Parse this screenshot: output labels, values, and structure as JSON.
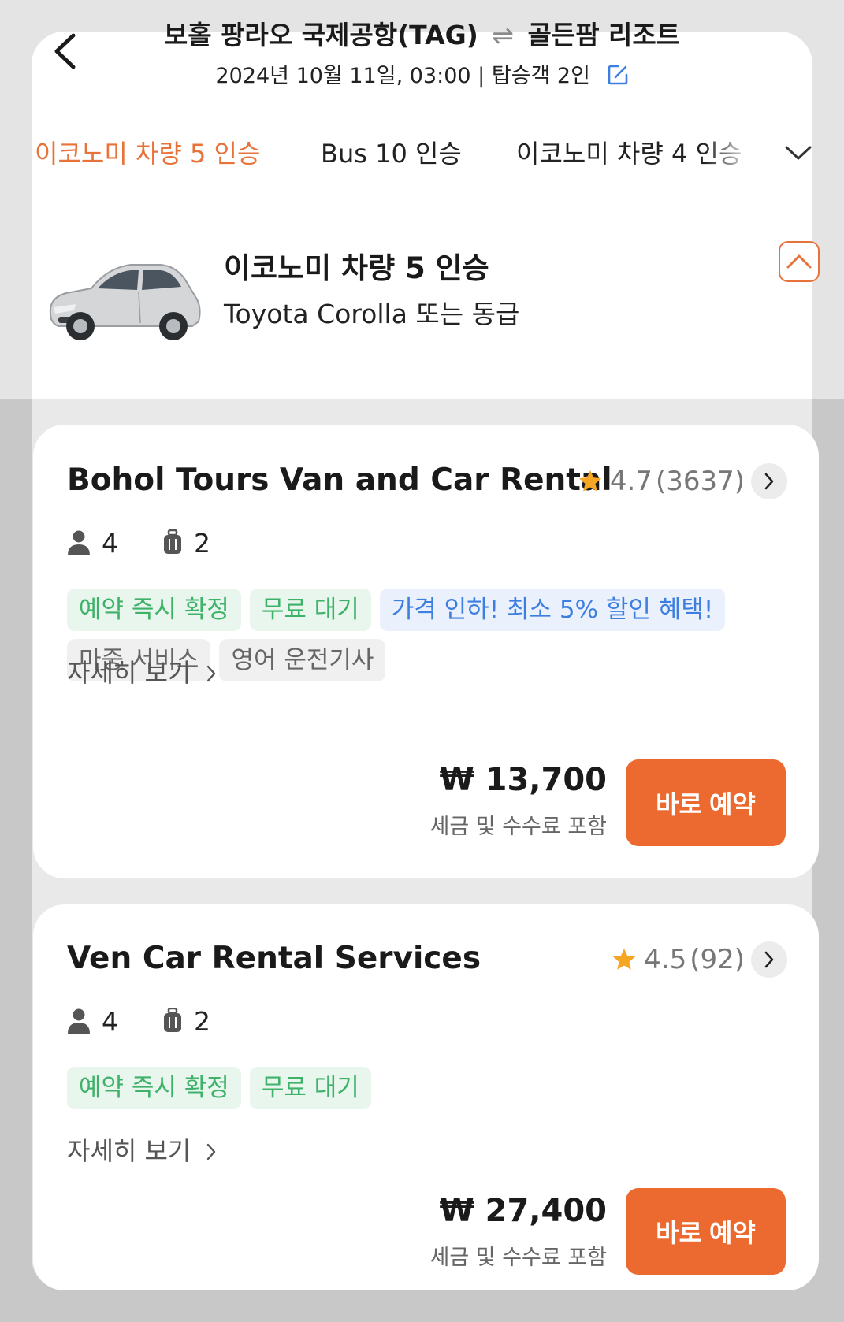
{
  "header": {
    "origin": "보홀 팡라오 국제공항(TAG)",
    "swap_symbol": "⇌",
    "destination": "골든팜 리조트",
    "subtitle": "2024년 10월 11일, 03:00 | 탑승객 2인"
  },
  "tabs": [
    {
      "label": "이코노미 차량 5 인승",
      "active": true
    },
    {
      "label": "Bus 10 인승",
      "active": false
    },
    {
      "label": "이코노미 차량 4 인승",
      "active": false
    }
  ],
  "vehicle": {
    "title": "이코노미 차량 5 인승",
    "subtitle": "Toyota Corolla 또는 동급"
  },
  "listings": [
    {
      "name": "Bohol Tours Van and Car Rental",
      "rating": "4.7",
      "review_count": "(3637)",
      "passengers": "4",
      "luggage": "2",
      "tags_row1": [
        "예약 즉시 확정",
        "무료 대기",
        "가격 인하! 최소 5% 할인 혜택!"
      ],
      "tags_row2": [
        "마중 서비스",
        "영어 운전기사"
      ],
      "details_label": "자세히 보기",
      "price": "₩ 13,700",
      "price_note": "세금 및 수수료 포함",
      "book_label": "바로 예약"
    },
    {
      "name": "Ven Car Rental Services",
      "rating": "4.5",
      "review_count": "(92)",
      "passengers": "4",
      "luggage": "2",
      "tags_row1": [
        "예약 즉시 확정",
        "무료 대기"
      ],
      "details_label": "자세히 보기",
      "price": "₩ 27,400",
      "price_note": "세금 및 수수료 포함",
      "book_label": "바로 예약"
    }
  ],
  "icons": {
    "back": "chevron-left-icon",
    "edit": "edit-icon",
    "tabs_more": "chevron-down-icon",
    "collapse": "chevron-up-icon",
    "star": "star-icon",
    "passenger": "person-icon",
    "luggage": "luggage-icon"
  },
  "colors": {
    "accent": "#e8733a",
    "book_button": "#ec6a2f",
    "tag_green_text": "#3fb26a",
    "tag_blue_text": "#3d7fe0",
    "star": "#f5a623"
  }
}
